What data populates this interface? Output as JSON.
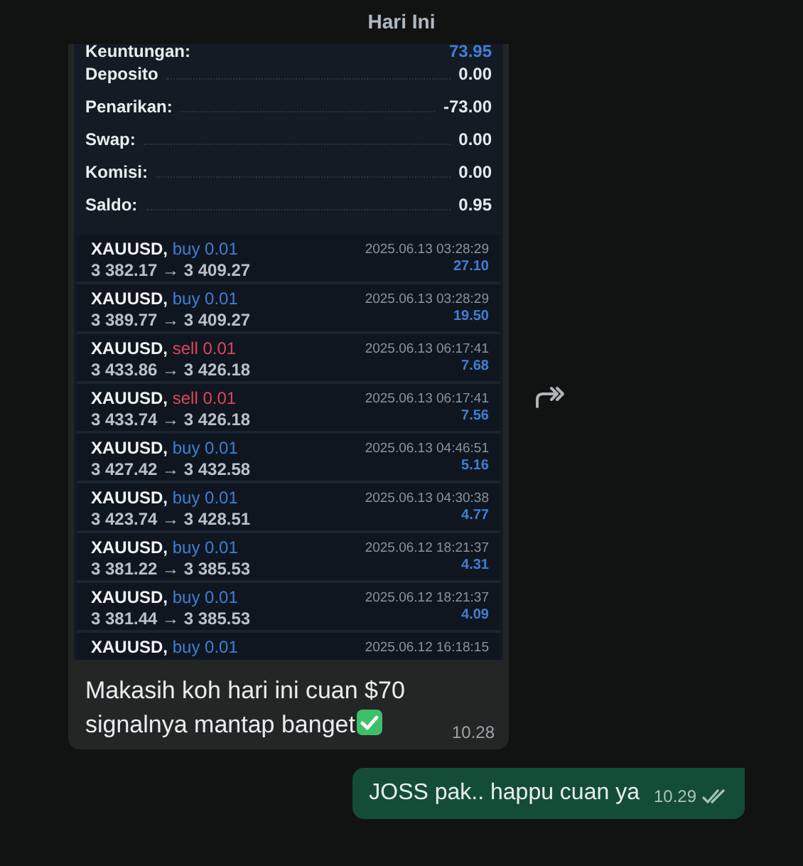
{
  "header": {
    "date": "Hari Ini"
  },
  "messages": [
    {
      "kind": "incoming_image",
      "screenshot": {
        "summary": [
          {
            "label": "Keuntungan:",
            "value": "73.95",
            "color": "#3f7fd6"
          },
          {
            "label": "Deposito",
            "value": "0.00",
            "color": "#e6e9ee"
          },
          {
            "label": "Penarikan:",
            "value": "-73.00",
            "color": "#e6e9ee"
          },
          {
            "label": "Swap:",
            "value": "0.00",
            "color": "#e6e9ee"
          },
          {
            "label": "Komisi:",
            "value": "0.00",
            "color": "#e6e9ee"
          },
          {
            "label": "Saldo:",
            "value": "0.95",
            "color": "#e6e9ee"
          }
        ],
        "trades": [
          {
            "symbol": "XAUUSD,",
            "order": "buy 0.01",
            "color": "#3f7fd6",
            "prices": "3 382.17 → 3 409.27",
            "time": "2025.06.13 03:28:29",
            "profit": "27.10"
          },
          {
            "symbol": "XAUUSD,",
            "order": "buy 0.01",
            "color": "#3f7fd6",
            "prices": "3 389.77 → 3 409.27",
            "time": "2025.06.13 03:28:29",
            "profit": "19.50"
          },
          {
            "symbol": "XAUUSD,",
            "order": "sell 0.01",
            "color": "#e0455c",
            "prices": "3 433.86 → 3 426.18",
            "time": "2025.06.13 06:17:41",
            "profit": "7.68"
          },
          {
            "symbol": "XAUUSD,",
            "order": "sell 0.01",
            "color": "#e0455c",
            "prices": "3 433.74 → 3 426.18",
            "time": "2025.06.13 06:17:41",
            "profit": "7.56"
          },
          {
            "symbol": "XAUUSD,",
            "order": "buy 0.01",
            "color": "#3f7fd6",
            "prices": "3 427.42 → 3 432.58",
            "time": "2025.06.13 04:46:51",
            "profit": "5.16"
          },
          {
            "symbol": "XAUUSD,",
            "order": "buy 0.01",
            "color": "#3f7fd6",
            "prices": "3 423.74 → 3 428.51",
            "time": "2025.06.13 04:30:38",
            "profit": "4.77"
          },
          {
            "symbol": "XAUUSD,",
            "order": "buy 0.01",
            "color": "#3f7fd6",
            "prices": "3 381.22 → 3 385.53",
            "time": "2025.06.12 18:21:37",
            "profit": "4.31"
          },
          {
            "symbol": "XAUUSD,",
            "order": "buy 0.01",
            "color": "#3f7fd6",
            "prices": "3 381.44 → 3 385.53",
            "time": "2025.06.12 18:21:37",
            "profit": "4.09"
          },
          {
            "symbol": "XAUUSD,",
            "order": "buy 0.01",
            "color": "#3f7fd6",
            "time": "2025.06.12 16:18:15"
          }
        ]
      },
      "text": "Makasih koh hari ini cuan $70 signalnya mantap banget",
      "time": "10.28"
    },
    {
      "kind": "outgoing_text",
      "text": "JOSS pak.. happu cuan ya",
      "time": "10.29",
      "read": false
    }
  ]
}
